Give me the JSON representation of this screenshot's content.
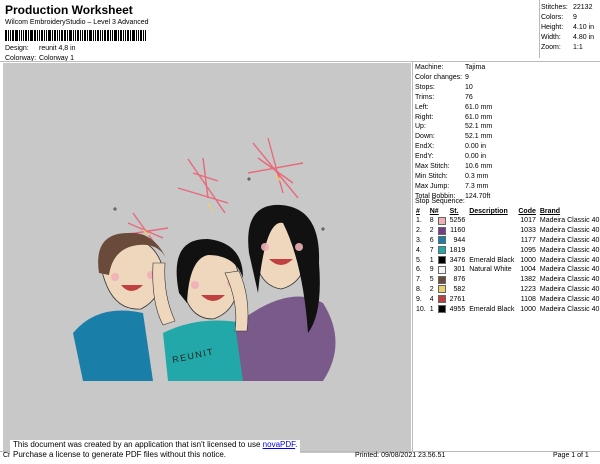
{
  "header": {
    "title": "Production Worksheet",
    "subtitle": "Wilcom EmbroideryStudio – Level 3 Advanced",
    "design_label": "Design:",
    "design_value": "reunit 4,8 in",
    "colorway_label": "Colorway:",
    "colorway_value": "Colorway 1"
  },
  "stats": {
    "stitches_label": "Stitches:",
    "stitches_value": "22132",
    "colors_label": "Colors:",
    "colors_value": "9",
    "height_label": "Height:",
    "height_value": "4.10 in",
    "width_label": "Width:",
    "width_value": "4.80 in",
    "zoom_label": "Zoom:",
    "zoom_value": "1:1"
  },
  "machine": {
    "rows": [
      {
        "label": "Machine:",
        "value": "Tajima"
      },
      {
        "label": "Color changes:",
        "value": "9"
      },
      {
        "label": "Stops:",
        "value": "10"
      },
      {
        "label": "Trims:",
        "value": "76"
      },
      {
        "label": "Left:",
        "value": "61.0 mm"
      },
      {
        "label": "Right:",
        "value": "61.0 mm"
      },
      {
        "label": "Up:",
        "value": "52.1 mm"
      },
      {
        "label": "Down:",
        "value": "52.1 mm"
      },
      {
        "label": "EndX:",
        "value": "0.00 in"
      },
      {
        "label": "EndY:",
        "value": "0.00 in"
      },
      {
        "label": "Max Stitch:",
        "value": "10.6 mm"
      },
      {
        "label": "Min Stitch:",
        "value": "0.3 mm"
      },
      {
        "label": "Max Jump:",
        "value": "7.3 mm"
      },
      {
        "label": "Total Bobbin:",
        "value": "124.70ft"
      }
    ]
  },
  "stop_sequence": {
    "title": "Stop Sequence:",
    "headers": [
      "#",
      "N#",
      "St.",
      "Description",
      "Code",
      "Brand"
    ],
    "rows": [
      {
        "n": "1.",
        "nn": "8",
        "color": "#f0b0b8",
        "st": "5256",
        "desc": "",
        "code": "1017",
        "brand": "Madeira Classic 40"
      },
      {
        "n": "2.",
        "nn": "2",
        "color": "#7a3a8a",
        "st": "1160",
        "desc": "",
        "code": "1033",
        "brand": "Madeira Classic 40"
      },
      {
        "n": "3.",
        "nn": "6",
        "color": "#1a7fa8",
        "st": "944",
        "desc": "",
        "code": "1177",
        "brand": "Madeira Classic 40"
      },
      {
        "n": "4.",
        "nn": "7",
        "color": "#22a8a8",
        "st": "1819",
        "desc": "",
        "code": "1095",
        "brand": "Madeira Classic 40"
      },
      {
        "n": "5.",
        "nn": "1",
        "color": "#000000",
        "st": "3476",
        "desc": "Emerald Black",
        "code": "1000",
        "brand": "Madeira Classic 40"
      },
      {
        "n": "6.",
        "nn": "9",
        "color": "#f6f6f6",
        "st": "301",
        "desc": "Natural White",
        "code": "1004",
        "brand": "Madeira Classic 40"
      },
      {
        "n": "7.",
        "nn": "5",
        "color": "#6a4a3a",
        "st": "876",
        "desc": "",
        "code": "1382",
        "brand": "Madeira Classic 40"
      },
      {
        "n": "8.",
        "nn": "2",
        "color": "#e8d070",
        "st": "582",
        "desc": "",
        "code": "1223",
        "brand": "Madeira Classic 40"
      },
      {
        "n": "9.",
        "nn": "4",
        "color": "#c04040",
        "st": "2761",
        "desc": "",
        "code": "1108",
        "brand": "Madeira Classic 40"
      },
      {
        "n": "10.",
        "nn": "1",
        "color": "#000000",
        "st": "4955",
        "desc": "Emerald Black",
        "code": "1000",
        "brand": "Madeira Classic 40"
      }
    ]
  },
  "artwork": {
    "lettering": "REUNIT"
  },
  "notice": {
    "line1_prefix": "This document was created by an application that isn't licensed to use ",
    "link": "novaPDF",
    "line1_suffix": ".",
    "line2": "Purchase a license to generate PDF files without this notice."
  },
  "footer": {
    "left": "Cr",
    "printed": "Printed: 09/08/2021 23.56.51",
    "page": "Page 1 of 1"
  }
}
